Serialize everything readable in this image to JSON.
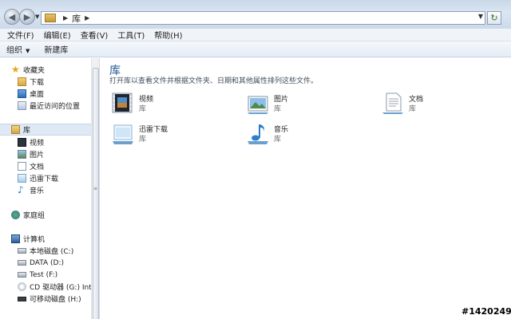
{
  "address": {
    "breadcrumb": "库"
  },
  "menu": [
    "文件(F)",
    "编辑(E)",
    "查看(V)",
    "工具(T)",
    "帮助(H)"
  ],
  "commands": {
    "organize": "组织",
    "new_library": "新建库"
  },
  "nav": {
    "favorites": "收藏夹",
    "fav_items": [
      "下载",
      "桌面",
      "最近访问的位置"
    ],
    "libraries": "库",
    "lib_items": [
      "视频",
      "图片",
      "文档",
      "迅雷下载",
      "音乐"
    ],
    "homegroup": "家庭组",
    "computer": "计算机",
    "drives": [
      "本地磁盘 (C:)",
      "DATA (D:)",
      "Test (F:)",
      "CD 驱动器 (G:) Intelli",
      "可移动磁盘 (H:)"
    ]
  },
  "content": {
    "title": "库",
    "subtitle": "打开库以查看文件并根据文件夹、日期和其他属性排列这些文件。",
    "tiles": [
      {
        "name": "视频",
        "type": "库"
      },
      {
        "name": "图片",
        "type": "库"
      },
      {
        "name": "文档",
        "type": "库"
      },
      {
        "name": "迅雷下载",
        "type": "库"
      },
      {
        "name": "音乐",
        "type": "库"
      }
    ]
  },
  "stamp": "#1420249"
}
